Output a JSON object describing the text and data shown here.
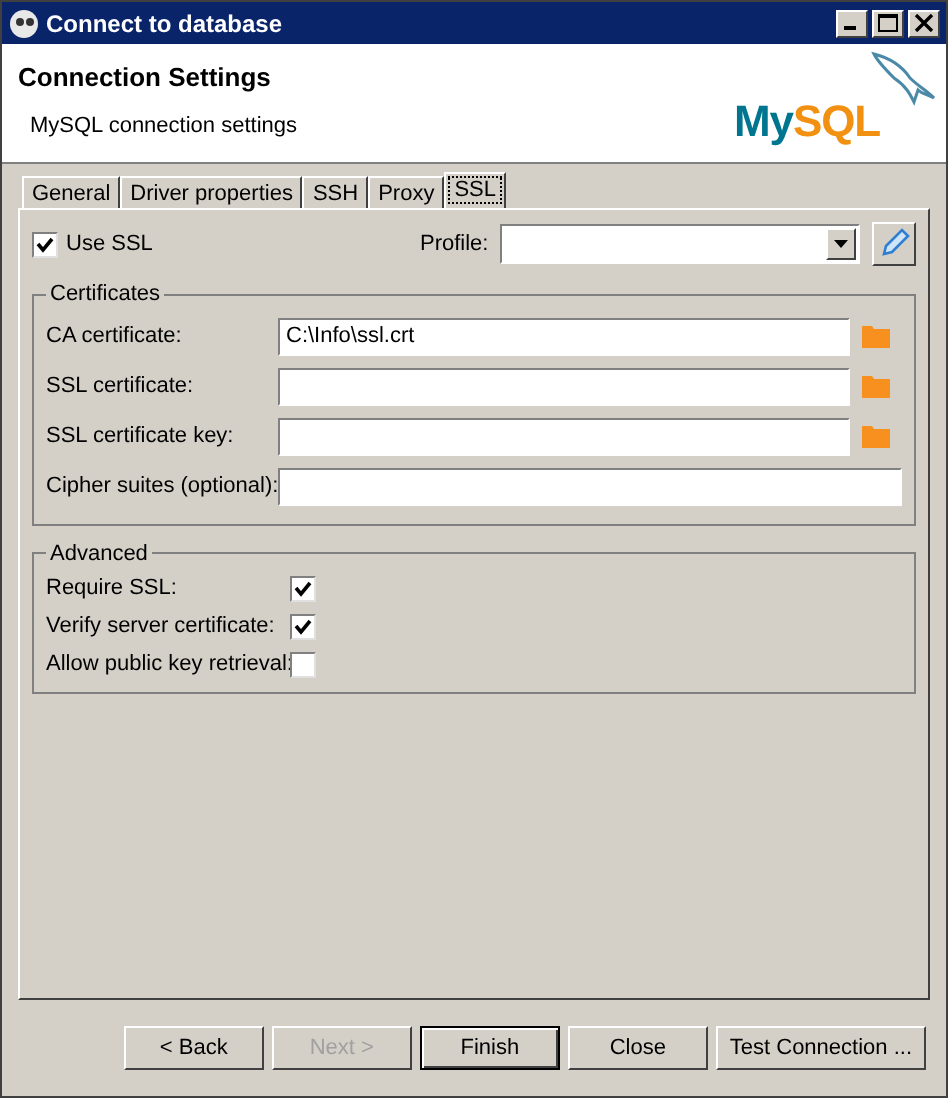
{
  "window": {
    "title": "Connect to database"
  },
  "header": {
    "title": "Connection Settings",
    "subtitle": "MySQL connection settings",
    "logo_parts": [
      "My",
      "SQL"
    ]
  },
  "tabs": [
    {
      "label": "General",
      "selected": false
    },
    {
      "label": "Driver properties",
      "selected": false
    },
    {
      "label": "SSH",
      "selected": false
    },
    {
      "label": "Proxy",
      "selected": false
    },
    {
      "label": "SSL",
      "selected": true
    }
  ],
  "use_ssl": {
    "label": "Use SSL",
    "checked": true
  },
  "profile": {
    "label": "Profile:"
  },
  "certificates": {
    "title": "Certificates",
    "fields": [
      {
        "label": "CA certificate:",
        "value": "C:\\Info\\ssl.crt",
        "browse": true
      },
      {
        "label": "SSL certificate:",
        "browse": true
      },
      {
        "label": "SSL certificate key:",
        "browse": true
      },
      {
        "label": "Cipher suites (optional):",
        "browse": false
      }
    ]
  },
  "advanced": {
    "title": "Advanced",
    "options": [
      {
        "label": "Require SSL:",
        "checked": true
      },
      {
        "label": "Verify server certificate:",
        "checked": true
      },
      {
        "label": "Allow public key retrieval:",
        "checked": false
      }
    ]
  },
  "buttons": [
    {
      "label": "< Back",
      "disabled": false,
      "default": false
    },
    {
      "label": "Next >",
      "disabled": true,
      "default": false
    },
    {
      "label": "Finish",
      "disabled": false,
      "default": true
    },
    {
      "label": "Close",
      "disabled": false,
      "default": false
    },
    {
      "label": "Test Connection ...",
      "disabled": false,
      "default": false
    }
  ]
}
